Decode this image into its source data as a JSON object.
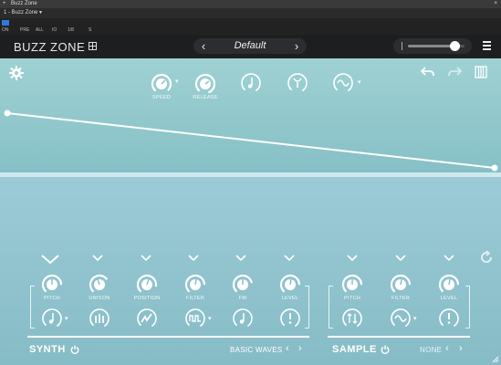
{
  "host": {
    "window_title": "Buzz Zone",
    "track_label": "1 - Buzz Zone",
    "toolbar_cells": [
      "ON",
      "PRE",
      "ALL",
      "IO",
      "1/8",
      "S"
    ]
  },
  "header": {
    "brand": "BUZZ ZONE",
    "preset_name": "Default",
    "prev_arrow": "‹",
    "next_arrow": "›",
    "volume_level": 0.82
  },
  "top_controls": {
    "knobs": [
      {
        "label": "SPEED",
        "value": 0.7
      },
      {
        "label": "RELEASE",
        "value": 0.75
      }
    ]
  },
  "synth": {
    "title": "SYNTH",
    "source_name": "BASIC WAVES",
    "knobs": [
      {
        "label": "PITCH",
        "value": 0.5
      },
      {
        "label": "UNISON",
        "value": 0.45
      },
      {
        "label": "POSITION",
        "value": 0.6
      },
      {
        "label": "FILTER",
        "value": 0.55
      },
      {
        "label": "FM",
        "value": 0.5
      },
      {
        "label": "LEVEL",
        "value": 0.55
      }
    ]
  },
  "sample": {
    "title": "SAMPLE",
    "source_name": "NONE",
    "knobs": [
      {
        "label": "PITCH",
        "value": 0.5
      },
      {
        "label": "FILTER",
        "value": 0.55
      },
      {
        "label": "LEVEL",
        "value": 0.55
      }
    ]
  },
  "icons": [
    "gear-icon",
    "undo-icon",
    "redo-icon",
    "keys-icon",
    "refresh-icon",
    "power-icon",
    "note-icon",
    "fork-icon",
    "wave-icon",
    "exclaim-icon",
    "bars-icon",
    "zigzag-icon",
    "sine-icon",
    "updown-icon",
    "sine-mod-icon"
  ]
}
